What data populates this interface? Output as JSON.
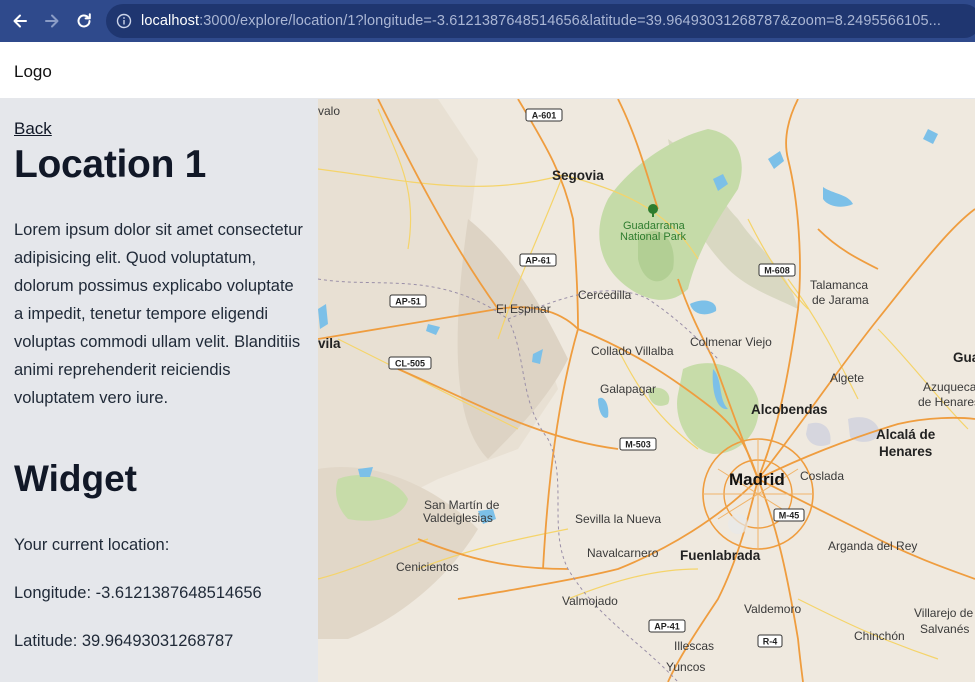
{
  "browser": {
    "back_icon": "arrow-left-icon",
    "forward_icon": "arrow-right-icon",
    "reload_icon": "reload-icon",
    "url_host": "localhost",
    "url_rest": ":3000/explore/location/1?longitude=-3.6121387648514656&latitude=39.96493031268787&zoom=8.2495566105..."
  },
  "header": {
    "logo": "Logo"
  },
  "sidebar": {
    "back_label": "Back",
    "title": "Location 1",
    "description": "Lorem ipsum dolor sit amet consectetur adipisicing elit. Quod voluptatum, dolorum possimus explicabo voluptate a impedit, tenetur tempore eligendi voluptas commodi ullam velit. Blanditiis animi reprehenderit reiciendis voluptatem vero iure.",
    "widget_title": "Widget",
    "current_location_label": "Your current location:",
    "longitude_text": "Longitude: -3.6121387648514656",
    "latitude_text": "Latitude: 39.96493031268787"
  },
  "map": {
    "places": {
      "valo": "valo",
      "segovia": "Segovia",
      "guadarrama1": "Guadarrama",
      "guadarrama2": "National Park",
      "cercedilla": "Cercedilla",
      "el_espinar": "El Espinar",
      "talamanca1": "Talamanca",
      "talamanca2": "de Jarama",
      "avila": "vila",
      "collado": "Collado Villalba",
      "colmenar": "Colmenar Viejo",
      "gua": "Gua",
      "algete": "Algete",
      "azuqueca1": "Azuqueca",
      "azuqueca2": "de Henares",
      "galapagar": "Galapagar",
      "alcobendas": "Alcobendas",
      "alcala1": "Alcalá de",
      "alcala2": "Henares",
      "madrid": "Madrid",
      "coslada": "Coslada",
      "sanmartin1": "San Martín de",
      "sanmartin2": "Valdeiglesias",
      "sevilla": "Sevilla la Nueva",
      "arganda": "Arganda del Rey",
      "cenicientos": "Cenicientos",
      "navalcarnero": "Navalcarnero",
      "fuenlabrada": "Fuenlabrada",
      "valmojado": "Valmojado",
      "valdemoro": "Valdemoro",
      "villarejo1": "Villarejo de",
      "villarejo2": "Salvanés",
      "chinchon": "Chinchón",
      "illescas": "Illescas",
      "yuncos": "Yuncos"
    },
    "roads": {
      "a601": "A-601",
      "ap61": "AP-61",
      "m608": "M-608",
      "ap51": "AP-51",
      "cl505": "CL-505",
      "m503": "M-503",
      "m45": "M-45",
      "ap41": "AP-41",
      "r4": "R-4"
    },
    "park_icon": "tree-icon"
  }
}
